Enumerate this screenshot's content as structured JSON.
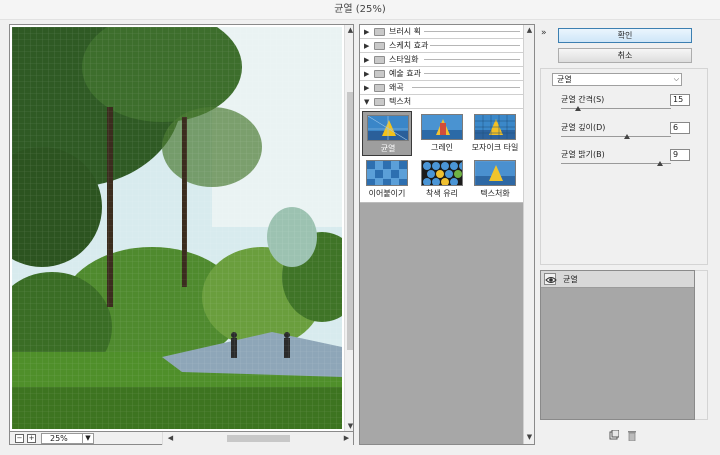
{
  "window": {
    "title": "균열 (25%)"
  },
  "preview": {
    "zoom": "25%",
    "zoom_out_icon": "minus-square-icon",
    "zoom_in_icon": "plus-square-icon"
  },
  "gallery": {
    "categories": [
      {
        "label": "브러시 획",
        "expanded": false
      },
      {
        "label": "스케치 효과",
        "expanded": false
      },
      {
        "label": "스타일화",
        "expanded": false
      },
      {
        "label": "예술 효과",
        "expanded": false
      },
      {
        "label": "왜곡",
        "expanded": false
      },
      {
        "label": "텍스처",
        "expanded": true
      }
    ],
    "texture_filters": [
      {
        "label": "균열",
        "selected": true
      },
      {
        "label": "그레인",
        "selected": false
      },
      {
        "label": "모자이크 타일",
        "selected": false
      },
      {
        "label": "이어붙이기",
        "selected": false
      },
      {
        "label": "착색 유리",
        "selected": false
      },
      {
        "label": "텍스처화",
        "selected": false
      }
    ]
  },
  "buttons": {
    "ok": "확인",
    "cancel": "취소"
  },
  "settings": {
    "filter": "균열",
    "params": [
      {
        "label": "균열 간격(S)",
        "value": "15",
        "fraction": 0.15
      },
      {
        "label": "균열 깊이(D)",
        "value": "6",
        "fraction": 0.6
      },
      {
        "label": "균열 밝기(B)",
        "value": "9",
        "fraction": 0.9
      }
    ]
  },
  "layers": {
    "items": [
      {
        "name": "균열",
        "visible": true
      }
    ]
  }
}
